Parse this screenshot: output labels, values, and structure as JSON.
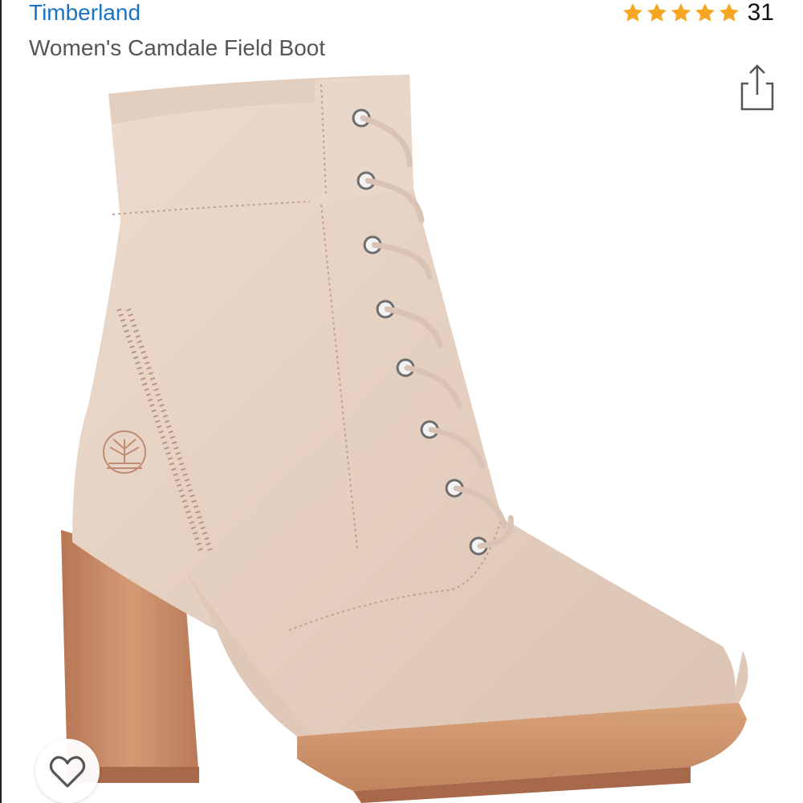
{
  "product": {
    "brand": "Timberland",
    "title": "Women's Camdale Field Boot"
  },
  "rating": {
    "stars": 5,
    "count": "31"
  },
  "icons": {
    "share": "share-icon",
    "wishlist": "heart-icon",
    "star": "star-icon"
  },
  "colors": {
    "brand_link": "#1a73c4",
    "star": "#f6a623",
    "boot_leather": "#e6d2c4",
    "heel_gum": "#c98a62"
  }
}
